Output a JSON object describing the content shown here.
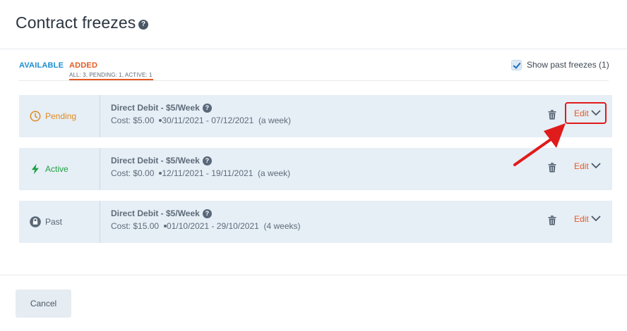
{
  "header": {
    "title": "Contract freezes",
    "help_icon_glyph": "?"
  },
  "tabs": [
    {
      "label": "AVAILABLE"
    },
    {
      "label": "ADDED",
      "sublabel": "ALL: 3, PENDING: 1, ACTIVE: 1"
    }
  ],
  "show_past": {
    "label": "Show past freezes (1)",
    "checked": true
  },
  "freezes": [
    {
      "status": "Pending",
      "status_icon": "clock-icon",
      "status_color": "#e08a1e",
      "name": "Direct Debit - $5/Week",
      "cost": "Cost: $5.00",
      "dates": "30/11/2021 -  07/12/2021",
      "duration": "(a week)",
      "edit_label": "Edit"
    },
    {
      "status": "Active",
      "status_icon": "lightning-icon",
      "status_color": "#22a045",
      "name": "Direct Debit - $5/Week",
      "cost": "Cost: $0.00",
      "dates": "12/11/2021 -  19/11/2021",
      "duration": "(a week)",
      "edit_label": "Edit"
    },
    {
      "status": "Past",
      "status_icon": "lock-icon",
      "status_color": "#596775",
      "name": "Direct Debit - $5/Week",
      "cost": "Cost: $15.00",
      "dates": "01/10/2021 -  29/10/2021",
      "duration": "(4 weeks)",
      "edit_label": "Edit"
    }
  ],
  "footer": {
    "cancel_label": "Cancel"
  },
  "colors": {
    "accent_orange": "#e55a22",
    "link_blue": "#1b8ecf",
    "row_bg": "#e6eef6",
    "highlight_red": "#e01b1b"
  }
}
